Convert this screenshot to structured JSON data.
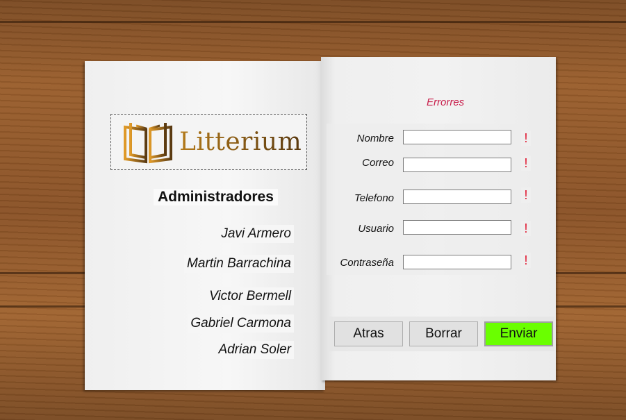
{
  "logo": {
    "text": "Litterium",
    "icon": "open-book-icon"
  },
  "admins": {
    "title": "Administradores",
    "names": [
      "Javi Armero",
      "Martin Barrachina",
      "Victor Bermell",
      "Gabriel Carmona",
      "Adrian Soler"
    ]
  },
  "form": {
    "errors_label": "Errorres",
    "fields": [
      {
        "label": "Nombre",
        "value": "",
        "error_mark": "!"
      },
      {
        "label": "Correo",
        "value": "",
        "error_mark": "!"
      },
      {
        "label": "Telefono",
        "value": "",
        "error_mark": "!"
      },
      {
        "label": "Usuario",
        "value": "",
        "error_mark": "!"
      },
      {
        "label": "Contraseña",
        "value": "",
        "error_mark": "!"
      }
    ]
  },
  "buttons": {
    "back": "Atras",
    "clear": "Borrar",
    "send": "Enviar"
  },
  "colors": {
    "send_button": "#6aff00",
    "error": "#e0102a",
    "errors_label": "#c81e4b"
  }
}
